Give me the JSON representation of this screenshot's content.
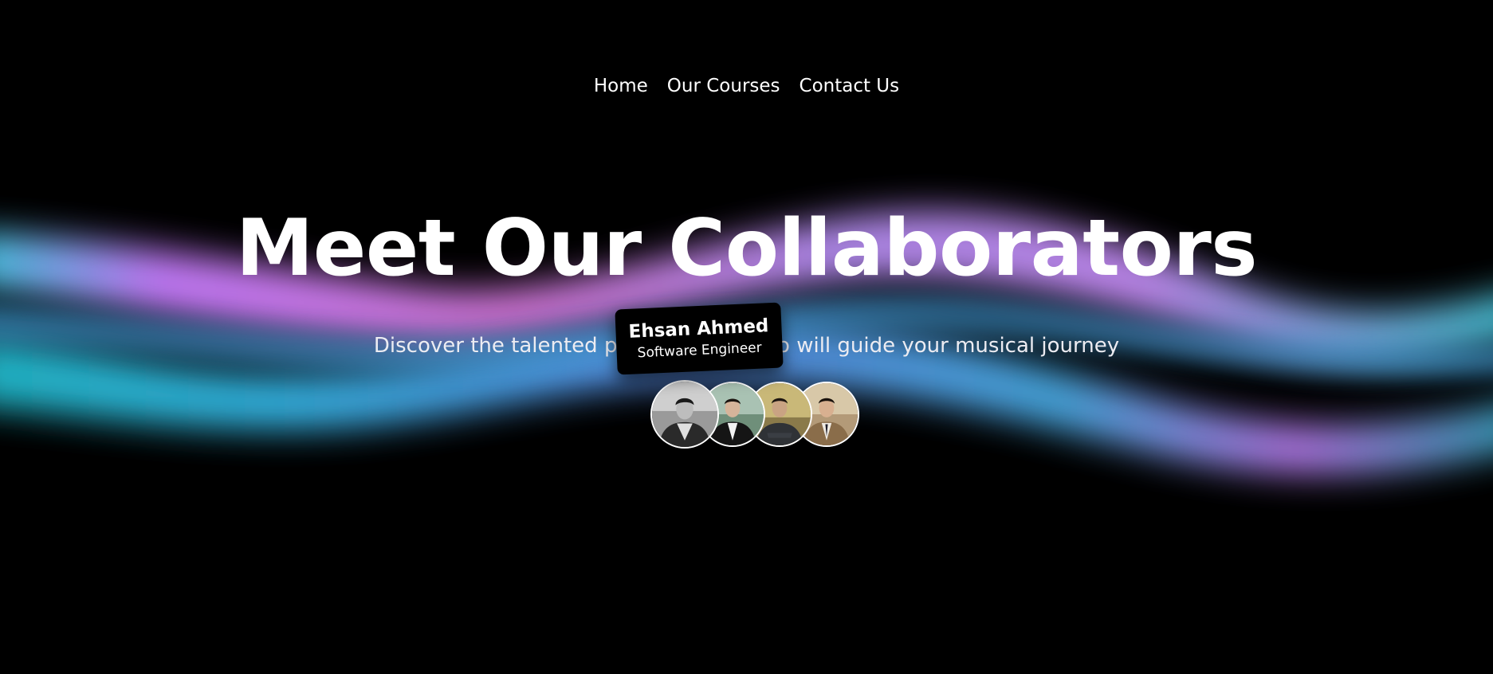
{
  "nav": {
    "items": [
      {
        "label": "Home"
      },
      {
        "label": "Our Courses"
      },
      {
        "label": "Contact Us"
      }
    ]
  },
  "hero": {
    "title": "Meet Our Collaborators",
    "subtitle": "Discover the talented professionals who will guide your musical journey"
  },
  "tooltip": {
    "name": "Ehsan Ahmed",
    "role": "Software Engineer"
  },
  "avatars": [
    {
      "icon": "person-photo-icon"
    },
    {
      "icon": "person-photo-icon"
    },
    {
      "icon": "person-photo-icon"
    },
    {
      "icon": "person-photo-icon"
    }
  ],
  "colors": {
    "background": "#000000",
    "text": "#ffffff",
    "wave_purple": "#c77dff",
    "wave_pink": "#e07fe0",
    "wave_cyan": "#2ec4e6",
    "wave_blue": "#5aa0e6"
  }
}
